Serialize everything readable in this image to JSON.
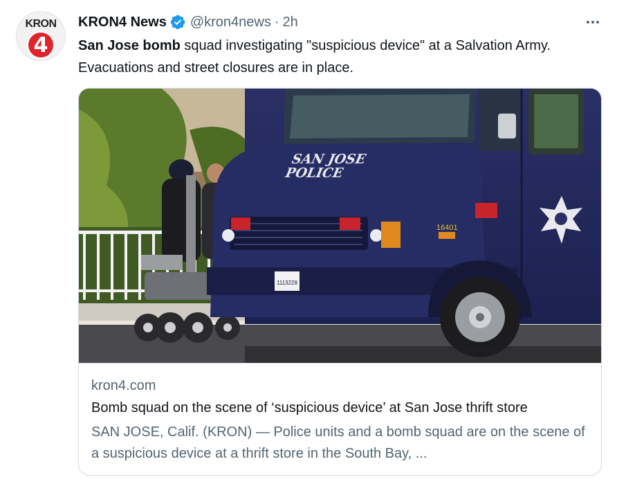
{
  "account": {
    "avatar": {
      "name": "kron4-logo-avatar",
      "text": "KRON",
      "number": "4",
      "color": "#e0242b"
    },
    "display_name": "KRON4 News",
    "verified_icon": "verified-badge-icon",
    "handle": "@kron4news",
    "separator": "·",
    "timestamp": "2h"
  },
  "menu": {
    "icon": "more-options-icon",
    "label": "•••"
  },
  "tweet": {
    "bold_text": "San Jose bomb",
    "text": " squad investigating \"suspicious device\" at a Salvation Army. Evacuations and street closures are in place."
  },
  "card": {
    "image": {
      "description": "image",
      "van_text_line1": "SAN JOSE",
      "van_text_line2": "POLICE",
      "unit_number": "16401",
      "license_plate": "1113228"
    },
    "domain": "kron4.com",
    "title": "Bomb squad on the scene of ‘suspicious device’ at San Jose thrift store",
    "description": "SAN JOSE, Calif. (KRON) — Police units and a bomb squad are on the scene of a suspicious device at a thrift store in the South Bay, ..."
  },
  "colors": {
    "text_primary": "#0f1419",
    "text_secondary": "#536471",
    "verified_blue": "#1d9bf0",
    "border": "#cfd9de",
    "van_blue": "#23285a"
  }
}
